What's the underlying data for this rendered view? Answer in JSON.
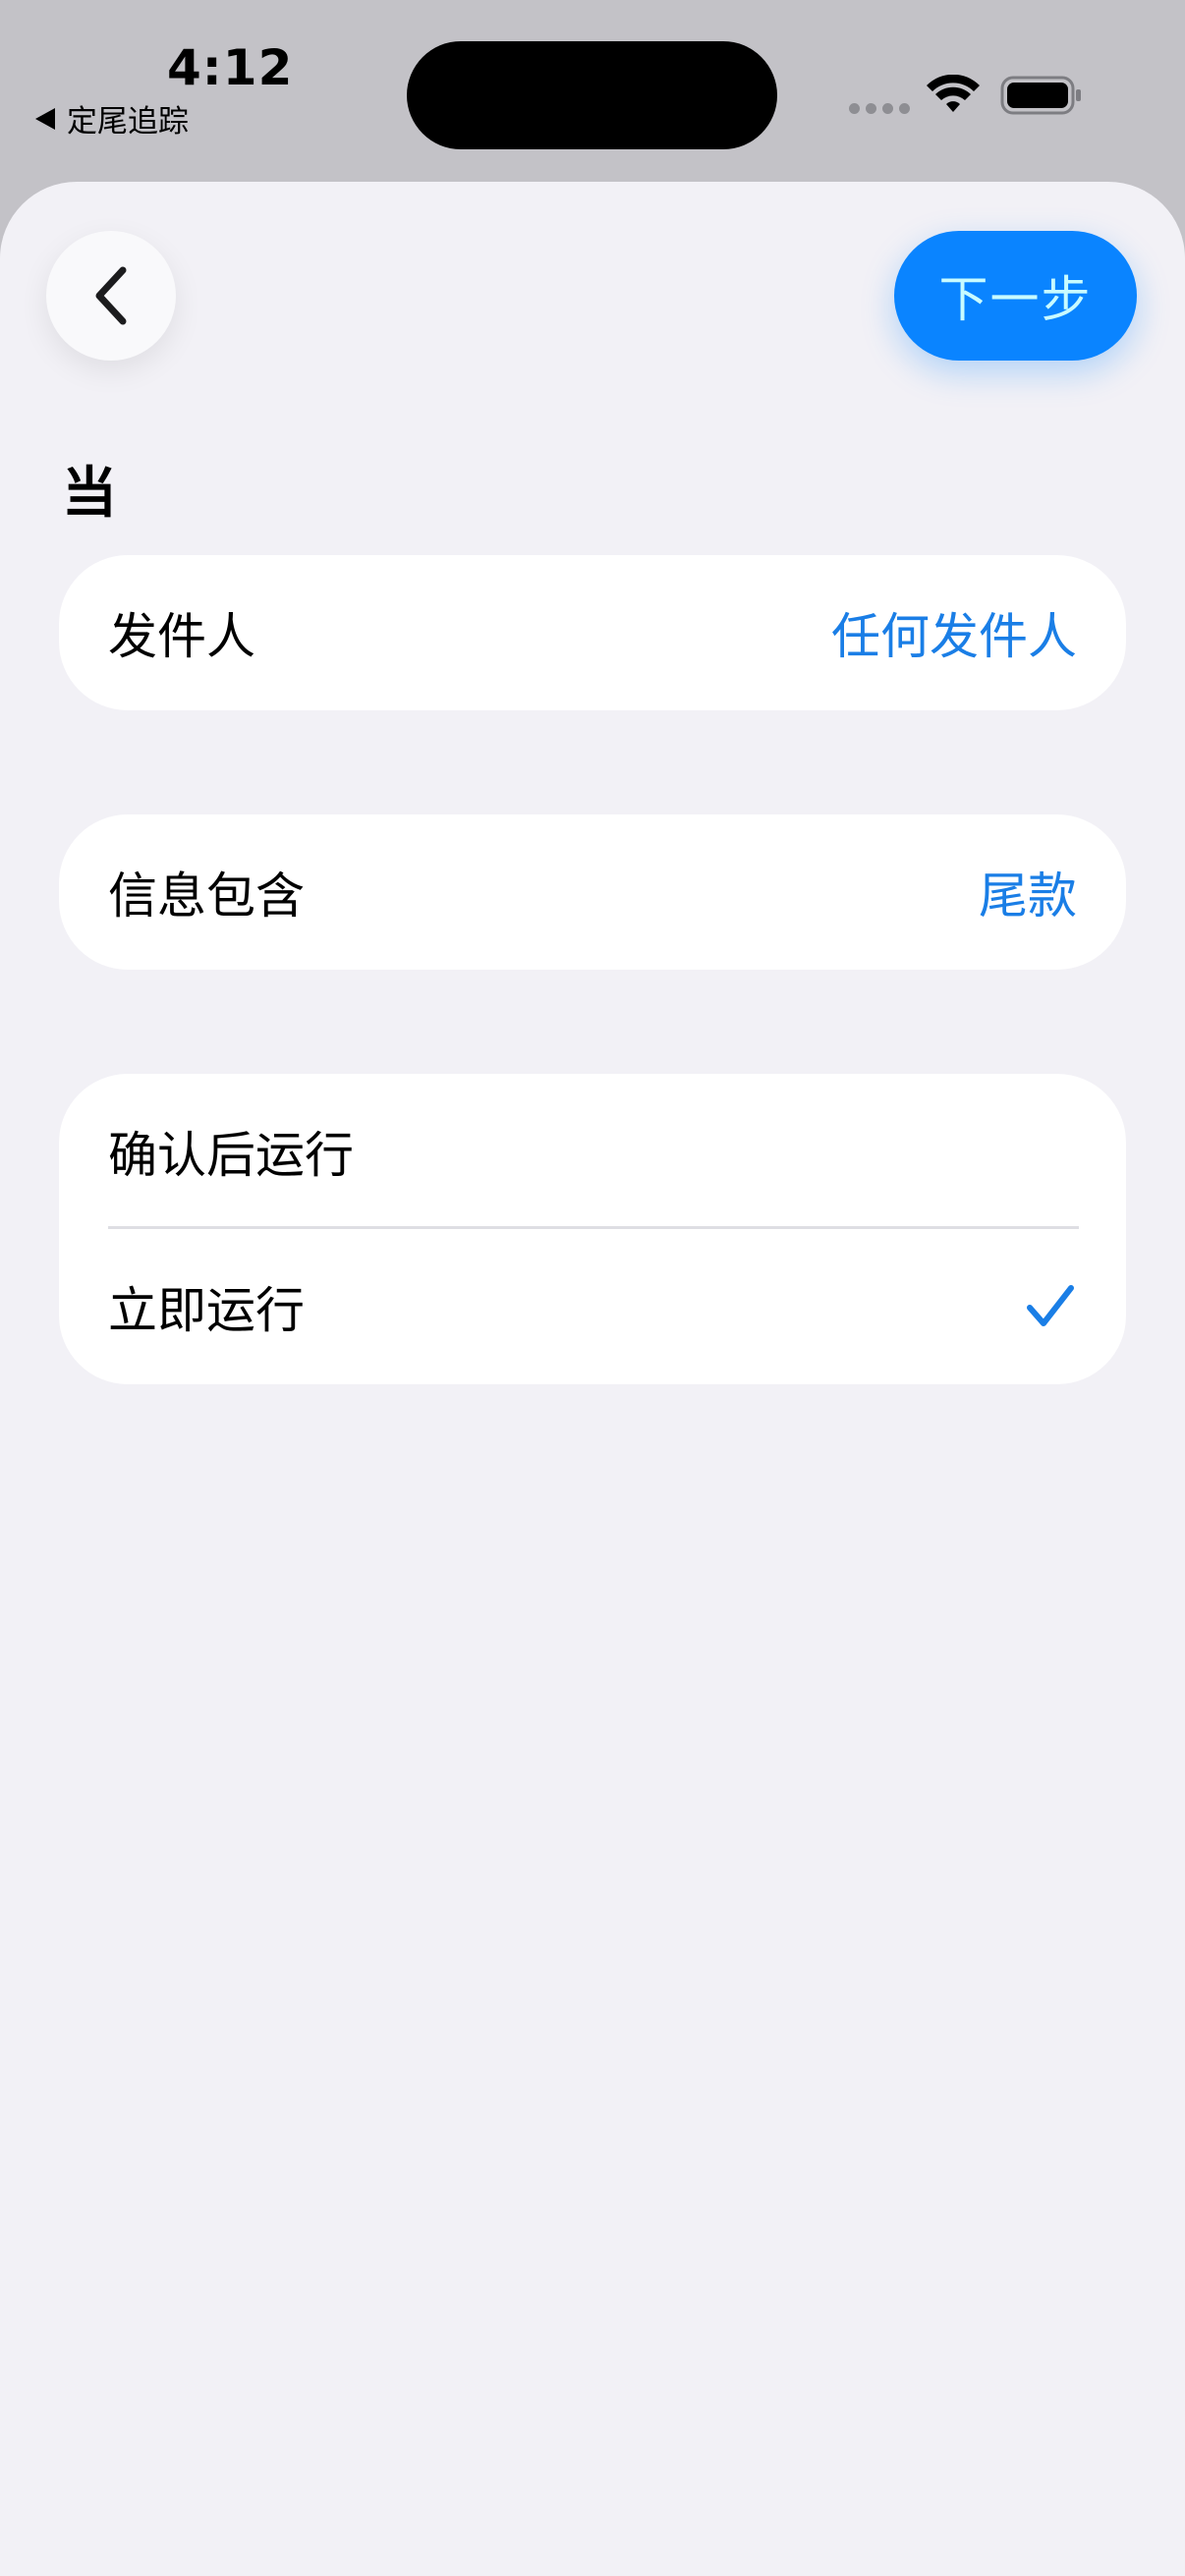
{
  "status_bar": {
    "time": "4:12",
    "back_app": "定尾追踪",
    "wifi_icon": "wifi-icon",
    "battery_icon": "battery-icon"
  },
  "nav": {
    "back_icon": "chevron-left-icon",
    "next_label": "下一步"
  },
  "section": {
    "title": "当"
  },
  "sender_row": {
    "label": "发件人",
    "value": "任何发件人"
  },
  "message_row": {
    "label": "信息包含",
    "value": "尾款"
  },
  "run_options": [
    {
      "label": "确认后运行",
      "selected": false
    },
    {
      "label": "立即运行",
      "selected": true
    }
  ],
  "colors": {
    "accent": "#0a84ff",
    "value_text": "#1a7ee6",
    "sheet_bg": "#f2f1f6",
    "status_bg": "#c3c2c7"
  }
}
